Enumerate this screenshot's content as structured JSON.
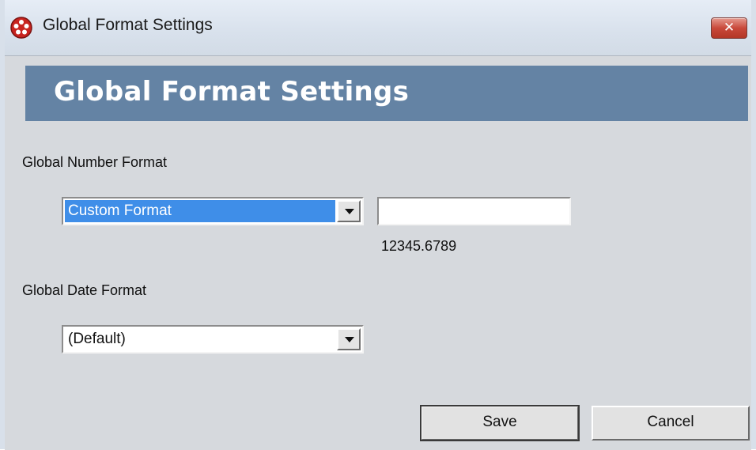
{
  "window": {
    "title": "Global Format Settings",
    "close_glyph": "✕",
    "app_icon": "red-circle-dots-icon"
  },
  "banner": {
    "title": "Global Format Settings",
    "color": "#6483a4"
  },
  "number_format": {
    "label": "Global Number Format",
    "selected_option": "Custom Format",
    "custom_value": "",
    "sample": "12345.6789"
  },
  "date_format": {
    "label": "Global Date Format",
    "selected_option": "(Default)"
  },
  "buttons": {
    "save": "Save",
    "cancel": "Cancel"
  }
}
